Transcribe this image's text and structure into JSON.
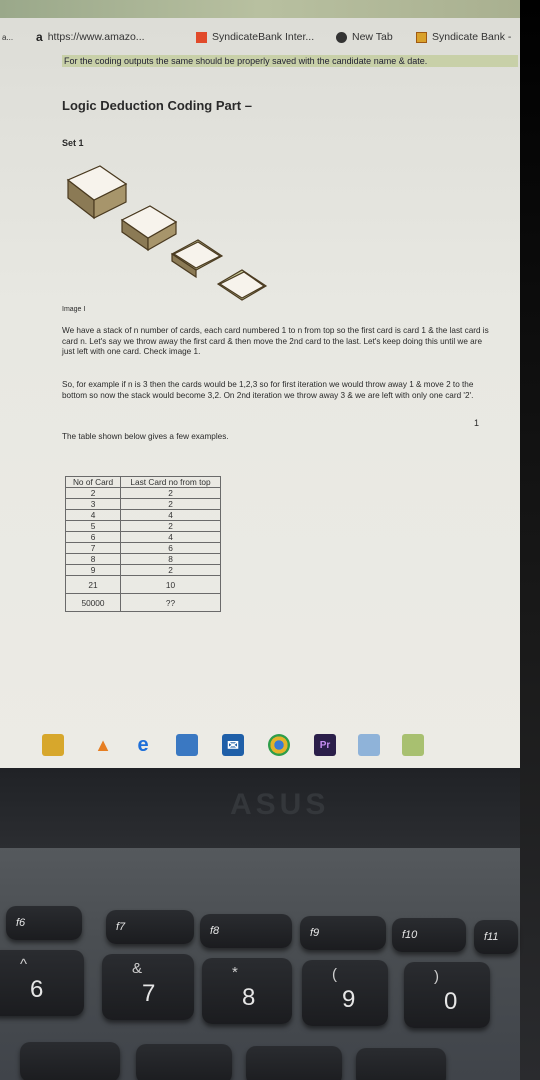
{
  "browser": {
    "bookmarks": [
      {
        "label": "https://www.amazo...",
        "icon": "amazon-a-icon"
      },
      {
        "label": "SyndicateBank Inter...",
        "icon": "syndicate-bank-icon"
      },
      {
        "label": "New Tab",
        "icon": "new-tab-icon"
      },
      {
        "label": "Syndicate Bank -",
        "icon": "syndicate-bank-icon"
      }
    ],
    "left_fragment": "a..."
  },
  "notice": "For the coding outputs the same should be properly saved with the candidate name & date.",
  "document": {
    "title": "Logic Deduction Coding Part –",
    "set_label": "Set 1",
    "image_caption": "Image I",
    "paragraphs": [
      "We have a stack of n number of cards, each card numbered 1 to n from top so the first card is card 1 & the last card is card n. Let's say we throw away the first card & then move the 2nd card to the last. Let's keep doing this until we are just left with one card. Check image 1.",
      "So, for example if n is 3 then the cards would be 1,2,3 so for first iteration we would throw away 1 & move 2 to the bottom so now the stack would become 3,2. On 2nd iteration we throw away 3 & we are left with only one card '2'.",
      "The table shown below gives a few examples."
    ],
    "stray_mark": "1",
    "table": {
      "headers": [
        "No of Card",
        "Last Card no from top"
      ],
      "rows": [
        [
          "2",
          "2"
        ],
        [
          "3",
          "2"
        ],
        [
          "4",
          "4"
        ],
        [
          "5",
          "2"
        ],
        [
          "6",
          "4"
        ],
        [
          "7",
          "6"
        ],
        [
          "8",
          "8"
        ],
        [
          "9",
          "2"
        ]
      ],
      "extra_rows": [
        [
          "21",
          "10"
        ],
        [
          "50000",
          "??"
        ]
      ]
    }
  },
  "taskbar": {
    "icons": [
      "file-explorer-icon",
      "vlc-icon",
      "edge-icon",
      "store-icon",
      "mail-icon",
      "chrome-icon",
      "premiere-icon",
      "photos-icon",
      "app-icon"
    ],
    "premiere_label": "Pr"
  },
  "laptop": {
    "brand": "ASUS",
    "function_keys": [
      "f6",
      "f7",
      "f8",
      "f9",
      "f10",
      "f11"
    ],
    "number_keys": [
      {
        "symbol": "^",
        "digit": "6"
      },
      {
        "symbol": "&",
        "digit": "7"
      },
      {
        "symbol": "*",
        "digit": "8"
      },
      {
        "symbol": "(",
        "digit": "9"
      },
      {
        "symbol": ")",
        "digit": "0"
      }
    ]
  }
}
